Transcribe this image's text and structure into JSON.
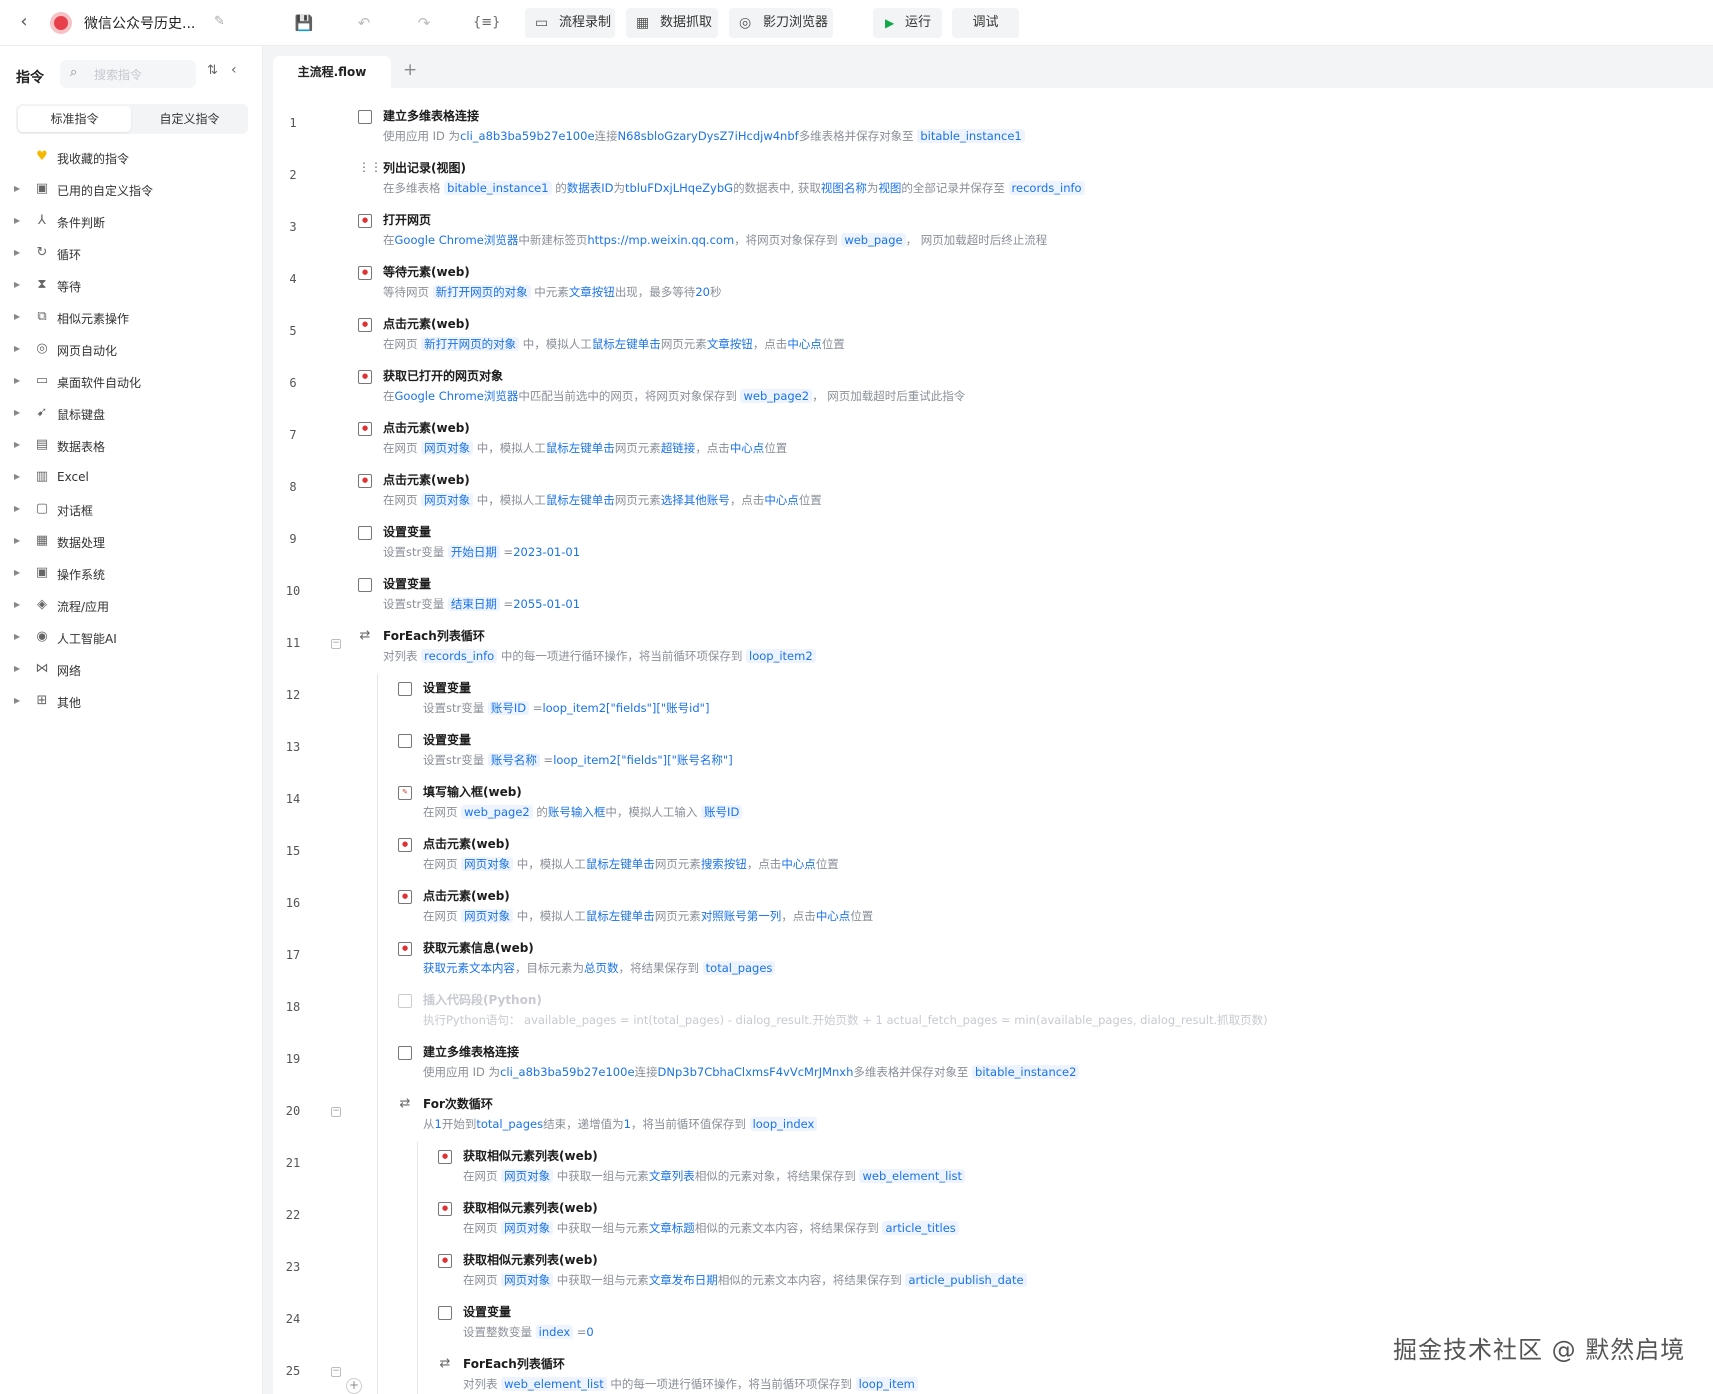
{
  "app": {
    "title": "微信公众号历史...",
    "toolbar": {
      "buttons": [
        "流程录制",
        "数据抓取",
        "影刀浏览器"
      ],
      "run_label": "运行",
      "debug_label": "调试"
    }
  },
  "sidebar": {
    "heading": "指令",
    "search_placeholder": "搜索指令",
    "tabs": [
      "标准指令",
      "自定义指令"
    ],
    "items": [
      {
        "label": "我收藏的指令",
        "icon": "heart-icon"
      },
      {
        "label": "已用的自定义指令",
        "icon": "custom-icon"
      },
      {
        "label": "条件判断",
        "icon": "branch-icon"
      },
      {
        "label": "循环",
        "icon": "loop-icon"
      },
      {
        "label": "等待",
        "icon": "hourglass-icon"
      },
      {
        "label": "相似元素操作",
        "icon": "copy-icon"
      },
      {
        "label": "网页自动化",
        "icon": "web-icon"
      },
      {
        "label": "桌面软件自动化",
        "icon": "monitor-icon"
      },
      {
        "label": "鼠标键盘",
        "icon": "cursor-icon"
      },
      {
        "label": "数据表格",
        "icon": "table-icon"
      },
      {
        "label": "Excel",
        "icon": "excel-icon"
      },
      {
        "label": "对话框",
        "icon": "dialog-icon"
      },
      {
        "label": "数据处理",
        "icon": "data-icon"
      },
      {
        "label": "操作系统",
        "icon": "os-icon"
      },
      {
        "label": "流程/应用",
        "icon": "layers-icon"
      },
      {
        "label": "人工智能AI",
        "icon": "ai-icon"
      },
      {
        "label": "网络",
        "icon": "network-icon"
      },
      {
        "label": "其他",
        "icon": "grid-icon"
      }
    ]
  },
  "editor": {
    "tab_name": "主流程.flow",
    "watermark": "掘金技术社区 @ 默然启境",
    "lines": [
      {
        "n": "1",
        "indent": 0,
        "icon": "link",
        "title": "建立多维表格连接",
        "desc": [
          [
            "t",
            "使用应用 ID 为"
          ],
          [
            "h",
            "cli_a8b3ba59b27e100e"
          ],
          [
            "t",
            "连接"
          ],
          [
            "h",
            "N68sbloGzaryDysZ7iHcdjw4nbf"
          ],
          [
            "t",
            "多维表格并保存对象至 "
          ],
          [
            "v",
            "bitable_instance1"
          ]
        ]
      },
      {
        "n": "2",
        "indent": 0,
        "icon": "grid",
        "title": "列出记录(视图)",
        "desc": [
          [
            "t",
            "在多维表格 "
          ],
          [
            "v",
            "bitable_instance1"
          ],
          [
            "t",
            " 的"
          ],
          [
            "h",
            "数据表ID"
          ],
          [
            "t",
            "为"
          ],
          [
            "h",
            "tbluFDxjLHqeZybG"
          ],
          [
            "t",
            "的数据表中, 获取"
          ],
          [
            "h",
            "视图名称"
          ],
          [
            "t",
            "为"
          ],
          [
            "h",
            "视图"
          ],
          [
            "t",
            "的全部记录并保存至 "
          ],
          [
            "v",
            "records_info"
          ]
        ]
      },
      {
        "n": "3",
        "indent": 0,
        "icon": "web",
        "title": "打开网页",
        "desc": [
          [
            "t",
            "在"
          ],
          [
            "h",
            "Google Chrome浏览器"
          ],
          [
            "t",
            "中新建标签页"
          ],
          [
            "h",
            "https://mp.weixin.qq.com"
          ],
          [
            "t",
            "，将网页对象保存到 "
          ],
          [
            "v",
            "web_page"
          ],
          [
            "t",
            "， 网页加载超时后终止流程"
          ]
        ]
      },
      {
        "n": "4",
        "indent": 0,
        "icon": "web",
        "title": "等待元素(web)",
        "desc": [
          [
            "t",
            "等待网页 "
          ],
          [
            "v",
            "新打开网页的对象"
          ],
          [
            "t",
            " 中元素"
          ],
          [
            "h",
            "文章按钮"
          ],
          [
            "t",
            "出现，最多等待"
          ],
          [
            "h",
            "20"
          ],
          [
            "t",
            "秒"
          ]
        ]
      },
      {
        "n": "5",
        "indent": 0,
        "icon": "web",
        "title": "点击元素(web)",
        "desc": [
          [
            "t",
            "在网页 "
          ],
          [
            "v",
            "新打开网页的对象"
          ],
          [
            "t",
            " 中，模拟人工"
          ],
          [
            "h",
            "鼠标左键单击"
          ],
          [
            "t",
            "网页元素"
          ],
          [
            "h",
            "文章按钮"
          ],
          [
            "t",
            "，点击"
          ],
          [
            "h",
            "中心点"
          ],
          [
            "t",
            "位置"
          ]
        ]
      },
      {
        "n": "6",
        "indent": 0,
        "icon": "web",
        "title": "获取已打开的网页对象",
        "desc": [
          [
            "t",
            "在"
          ],
          [
            "h",
            "Google Chrome浏览器"
          ],
          [
            "t",
            "中匹配当前选中的网页，将网页对象保存到 "
          ],
          [
            "v",
            "web_page2"
          ],
          [
            "t",
            "， 网页加载超时后重试此指令"
          ]
        ]
      },
      {
        "n": "7",
        "indent": 0,
        "icon": "web",
        "title": "点击元素(web)",
        "desc": [
          [
            "t",
            "在网页 "
          ],
          [
            "v",
            "网页对象"
          ],
          [
            "t",
            " 中，模拟人工"
          ],
          [
            "h",
            "鼠标左键单击"
          ],
          [
            "t",
            "网页元素"
          ],
          [
            "h",
            "超链接"
          ],
          [
            "t",
            "，点击"
          ],
          [
            "h",
            "中心点"
          ],
          [
            "t",
            "位置"
          ]
        ]
      },
      {
        "n": "8",
        "indent": 0,
        "icon": "web",
        "title": "点击元素(web)",
        "desc": [
          [
            "t",
            "在网页 "
          ],
          [
            "v",
            "网页对象"
          ],
          [
            "t",
            " 中，模拟人工"
          ],
          [
            "h",
            "鼠标左键单击"
          ],
          [
            "t",
            "网页元素"
          ],
          [
            "h",
            "选择其他账号"
          ],
          [
            "t",
            "，点击"
          ],
          [
            "h",
            "中心点"
          ],
          [
            "t",
            "位置"
          ]
        ]
      },
      {
        "n": "9",
        "indent": 0,
        "icon": "var",
        "title": "设置变量",
        "desc": [
          [
            "t",
            "设置str变量 "
          ],
          [
            "v",
            "开始日期"
          ],
          [
            "t",
            " ="
          ],
          [
            "h",
            "2023-01-01"
          ]
        ]
      },
      {
        "n": "10",
        "indent": 0,
        "icon": "var",
        "title": "设置变量",
        "desc": [
          [
            "t",
            "设置str变量 "
          ],
          [
            "v",
            "结束日期"
          ],
          [
            "t",
            " ="
          ],
          [
            "h",
            "2055-01-01"
          ]
        ]
      },
      {
        "n": "11",
        "indent": 0,
        "icon": "loop",
        "fold": true,
        "title": "ForEach列表循环",
        "desc": [
          [
            "t",
            "对列表 "
          ],
          [
            "v",
            "records_info"
          ],
          [
            "t",
            " 中的每一项进行循环操作，将当前循环项保存到 "
          ],
          [
            "v",
            "loop_item2"
          ]
        ]
      },
      {
        "n": "12",
        "indent": 1,
        "icon": "var",
        "title": "设置变量",
        "desc": [
          [
            "t",
            "设置str变量 "
          ],
          [
            "v",
            "账号ID"
          ],
          [
            "t",
            " ="
          ],
          [
            "h",
            "loop_item2[\"fields\"][\"账号id\"]"
          ]
        ]
      },
      {
        "n": "13",
        "indent": 1,
        "icon": "var",
        "title": "设置变量",
        "desc": [
          [
            "t",
            "设置str变量 "
          ],
          [
            "v",
            "账号名称"
          ],
          [
            "t",
            " ="
          ],
          [
            "h",
            "loop_item2[\"fields\"][\"账号名称\"]"
          ]
        ]
      },
      {
        "n": "14",
        "indent": 1,
        "icon": "input",
        "title": "填写输入框(web)",
        "desc": [
          [
            "t",
            "在网页 "
          ],
          [
            "v",
            "web_page2"
          ],
          [
            "t",
            " 的"
          ],
          [
            "h",
            "账号输入框"
          ],
          [
            "t",
            "中，模拟人工输入 "
          ],
          [
            "v",
            "账号ID"
          ]
        ]
      },
      {
        "n": "15",
        "indent": 1,
        "icon": "web",
        "title": "点击元素(web)",
        "desc": [
          [
            "t",
            "在网页 "
          ],
          [
            "v",
            "网页对象"
          ],
          [
            "t",
            " 中，模拟人工"
          ],
          [
            "h",
            "鼠标左键单击"
          ],
          [
            "t",
            "网页元素"
          ],
          [
            "h",
            "搜索按钮"
          ],
          [
            "t",
            "，点击"
          ],
          [
            "h",
            "中心点"
          ],
          [
            "t",
            "位置"
          ]
        ]
      },
      {
        "n": "16",
        "indent": 1,
        "icon": "web",
        "title": "点击元素(web)",
        "desc": [
          [
            "t",
            "在网页 "
          ],
          [
            "v",
            "网页对象"
          ],
          [
            "t",
            " 中，模拟人工"
          ],
          [
            "h",
            "鼠标左键单击"
          ],
          [
            "t",
            "网页元素"
          ],
          [
            "h",
            "对照账号第一列"
          ],
          [
            "t",
            "，点击"
          ],
          [
            "h",
            "中心点"
          ],
          [
            "t",
            "位置"
          ]
        ]
      },
      {
        "n": "17",
        "indent": 1,
        "icon": "web",
        "title": "获取元素信息(web)",
        "desc": [
          [
            "h",
            "获取元素文本内容"
          ],
          [
            "t",
            "，目标元素为"
          ],
          [
            "h",
            "总页数"
          ],
          [
            "t",
            "，将结果保存到 "
          ],
          [
            "v",
            "total_pages"
          ]
        ]
      },
      {
        "n": "18",
        "indent": 1,
        "icon": "code",
        "disabled": true,
        "title": "插入代码段(Python)",
        "desc": [
          [
            "t",
            "执行Python语句： "
          ],
          [
            "h",
            "available_pages = int(total_pages) - dialog_result.开始页数 + 1 actual_fetch_pages = min(available_pages, dialog_result.抓取页数)"
          ]
        ]
      },
      {
        "n": "19",
        "indent": 1,
        "icon": "link",
        "title": "建立多维表格连接",
        "desc": [
          [
            "t",
            "使用应用 ID 为"
          ],
          [
            "h",
            "cli_a8b3ba59b27e100e"
          ],
          [
            "t",
            "连接"
          ],
          [
            "h",
            "DNp3b7CbhaClxmsF4vVcMrJMnxh"
          ],
          [
            "t",
            "多维表格并保存对象至 "
          ],
          [
            "v",
            "bitable_instance2"
          ]
        ]
      },
      {
        "n": "20",
        "indent": 1,
        "icon": "loop",
        "fold": true,
        "title": "For次数循环",
        "desc": [
          [
            "t",
            "从"
          ],
          [
            "h",
            "1"
          ],
          [
            "t",
            "开始到"
          ],
          [
            "h",
            "total_pages"
          ],
          [
            "t",
            "结束，递增值为"
          ],
          [
            "h",
            "1"
          ],
          [
            "t",
            "，将当前循环值保存到 "
          ],
          [
            "v",
            "loop_index"
          ]
        ]
      },
      {
        "n": "21",
        "indent": 2,
        "icon": "web",
        "title": "获取相似元素列表(web)",
        "desc": [
          [
            "t",
            "在网页 "
          ],
          [
            "v",
            "网页对象"
          ],
          [
            "t",
            " 中获取一组与元素"
          ],
          [
            "h",
            "文章列表"
          ],
          [
            "t",
            "相似的元素对象，将结果保存到 "
          ],
          [
            "v",
            "web_element_list"
          ]
        ]
      },
      {
        "n": "22",
        "indent": 2,
        "icon": "web",
        "title": "获取相似元素列表(web)",
        "desc": [
          [
            "t",
            "在网页 "
          ],
          [
            "v",
            "网页对象"
          ],
          [
            "t",
            " 中获取一组与元素"
          ],
          [
            "h",
            "文章标题"
          ],
          [
            "t",
            "相似的元素文本内容，将结果保存到 "
          ],
          [
            "v",
            "article_titles"
          ]
        ]
      },
      {
        "n": "23",
        "indent": 2,
        "icon": "web",
        "title": "获取相似元素列表(web)",
        "desc": [
          [
            "t",
            "在网页 "
          ],
          [
            "v",
            "网页对象"
          ],
          [
            "t",
            " 中获取一组与元素"
          ],
          [
            "h",
            "文章发布日期"
          ],
          [
            "t",
            "相似的元素文本内容，将结果保存到 "
          ],
          [
            "v",
            "article_publish_date"
          ]
        ]
      },
      {
        "n": "24",
        "indent": 2,
        "icon": "var",
        "title": "设置变量",
        "desc": [
          [
            "t",
            "设置整数变量 "
          ],
          [
            "v",
            "index"
          ],
          [
            "t",
            " ="
          ],
          [
            "h",
            "0"
          ]
        ]
      },
      {
        "n": "25",
        "indent": 2,
        "icon": "loop",
        "fold": true,
        "title": "ForEach列表循环",
        "desc": [
          [
            "t",
            "对列表 "
          ],
          [
            "v",
            "web_element_list"
          ],
          [
            "t",
            " 中的每一项进行循环操作，将当前循环项保存到 "
          ],
          [
            "v",
            "loop_item"
          ]
        ]
      }
    ]
  }
}
